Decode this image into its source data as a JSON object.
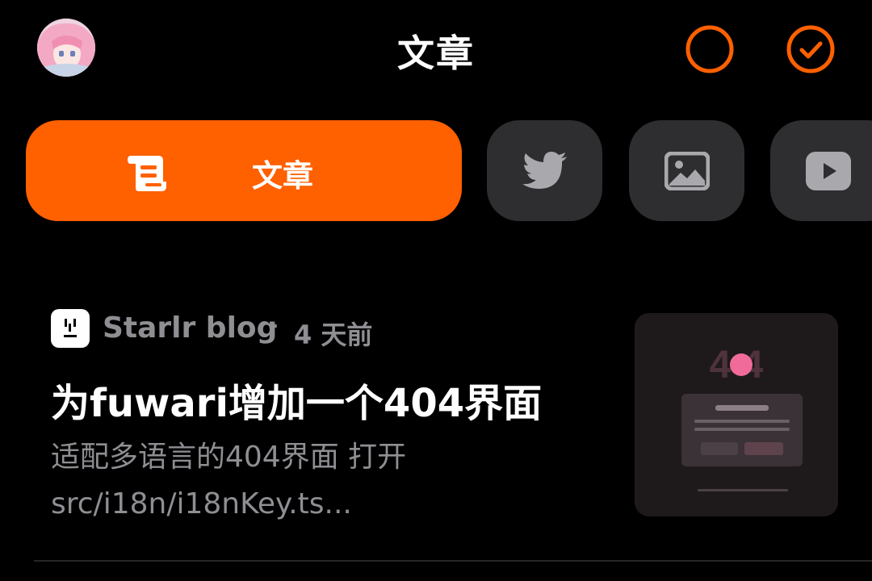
{
  "header": {
    "title": "文章"
  },
  "categories": [
    {
      "label": "文章",
      "icon": "scroll-icon",
      "active": true
    },
    {
      "label": "",
      "icon": "twitter-bird-icon",
      "active": false
    },
    {
      "label": "",
      "icon": "image-icon",
      "active": false
    },
    {
      "label": "",
      "icon": "video-play-icon",
      "active": false
    }
  ],
  "article": {
    "source": "Starlr blog",
    "separator": "·",
    "time_ago": "4 天前",
    "title": "为fuwari增加一个404界面",
    "summary": "适配多语言的404界面 打开src/i18n/i18nKey.ts..."
  },
  "colors": {
    "background": "#000000",
    "accent": "#ff6000",
    "pill_inactive": "#2e2e30",
    "muted_text": "#8e8e93"
  }
}
